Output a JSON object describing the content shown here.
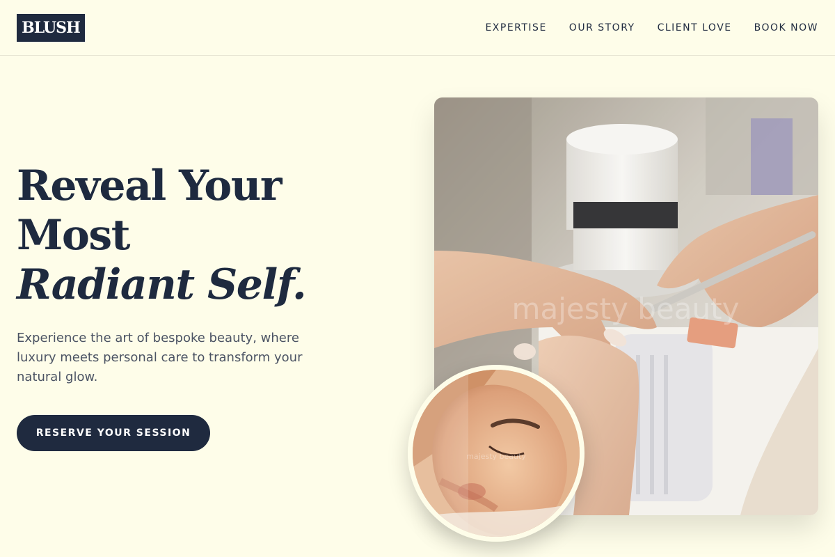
{
  "brand": {
    "logo_text": "BLUSH"
  },
  "nav": {
    "items": [
      {
        "label": "EXPERTISE"
      },
      {
        "label": "OUR STORY"
      },
      {
        "label": "CLIENT LOVE"
      },
      {
        "label": "BOOK NOW"
      }
    ]
  },
  "hero": {
    "headline_line1": "Reveal Your",
    "headline_line2": "Most",
    "headline_line3": "Radiant Self.",
    "subtext": "Experience the art of bespoke beauty, where luxury meets personal care to transform your natural glow.",
    "cta_label": "RESERVE YOUR SESSION"
  },
  "images": {
    "main_watermark": "majesty beauty",
    "circle_watermark": "majesty beauty"
  },
  "colors": {
    "background": "#fefde9",
    "primary_navy": "#1f2a3f",
    "body_text": "#4b5363"
  }
}
